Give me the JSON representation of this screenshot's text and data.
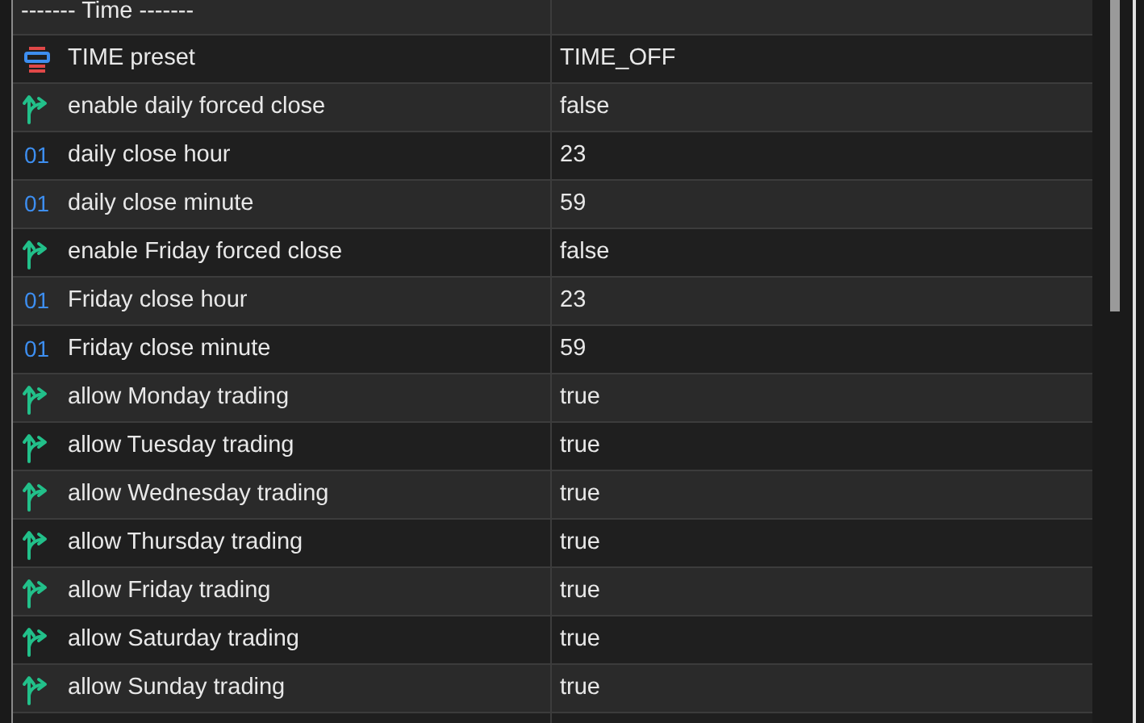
{
  "group_header": "------- Time -------",
  "parameters": [
    {
      "kind": "enum",
      "name": "TIME preset",
      "value": "TIME_OFF"
    },
    {
      "kind": "bool",
      "name": "enable daily forced close",
      "value": "false"
    },
    {
      "kind": "int",
      "icon": "01",
      "name": "daily close hour",
      "value": "23"
    },
    {
      "kind": "int",
      "icon": "01",
      "name": "daily close minute",
      "value": "59"
    },
    {
      "kind": "bool",
      "name": "enable Friday forced close",
      "value": "false"
    },
    {
      "kind": "int",
      "icon": "01",
      "name": "Friday close hour",
      "value": "23"
    },
    {
      "kind": "int",
      "icon": "01",
      "name": "Friday close minute",
      "value": "59"
    },
    {
      "kind": "bool",
      "name": "allow Monday trading",
      "value": "true"
    },
    {
      "kind": "bool",
      "name": "allow Tuesday trading",
      "value": "true"
    },
    {
      "kind": "bool",
      "name": "allow Wednesday trading",
      "value": "true"
    },
    {
      "kind": "bool",
      "name": "allow Thursday trading",
      "value": "true"
    },
    {
      "kind": "bool",
      "name": "allow Friday trading",
      "value": "true"
    },
    {
      "kind": "bool",
      "name": "allow Saturday trading",
      "value": "true"
    },
    {
      "kind": "bool",
      "name": "allow Sunday trading",
      "value": "true"
    }
  ]
}
